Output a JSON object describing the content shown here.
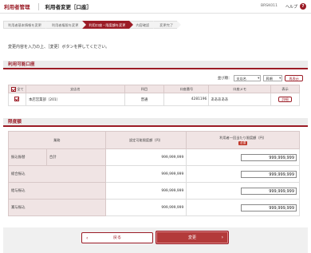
{
  "header": {
    "menu_title": "利用者管理",
    "page_title": "利用者変更［口座］",
    "screen_id": "BRSK011",
    "help_label": "ヘルプ",
    "help_icon": "?"
  },
  "steps": [
    {
      "label": "利用者基本情報を変更",
      "active": false
    },
    {
      "label": "利用者権限を変更",
      "active": false
    },
    {
      "label": "利用口座・限度額を変更",
      "active": true
    },
    {
      "label": "内容確認",
      "active": false
    },
    {
      "label": "変更完了",
      "active": false
    }
  ],
  "instruction": "変更内容を入力の上、［変更］ボタンを押してください。",
  "accounts_section": {
    "title": "利用可能口座",
    "sort": {
      "label": "並び順：",
      "sort_key": "支店名",
      "order": "昇順",
      "resort_button": "再表示"
    },
    "columns": [
      "全て",
      "支店名",
      "科目",
      "口座番号",
      "口座メモ",
      "表示"
    ],
    "rows": [
      {
        "checked": true,
        "branch": "本店営業部（201）",
        "subject": "普通",
        "account_no": "4281196",
        "memo": "あああああ",
        "detail_button": "詳細"
      }
    ]
  },
  "limits_section": {
    "title": "限度額",
    "columns": {
      "business": "業務",
      "bank_limit": "設定可能限度額（円）",
      "user_limit": "利用者一回当たり限度額（円）",
      "required_badge": "必須"
    },
    "rows": [
      {
        "business": "振込振替",
        "sub": "合計",
        "bank_limit": "999,999,999",
        "user_limit": "999,999,999"
      },
      {
        "business": "総合振込",
        "sub": "",
        "bank_limit": "999,999,999",
        "user_limit": "999,999,999"
      },
      {
        "business": "給与振込",
        "sub": "",
        "bank_limit": "999,999,999",
        "user_limit": "999,999,999"
      },
      {
        "business": "賞与振込",
        "sub": "",
        "bank_limit": "999,999,999",
        "user_limit": "999,999,999"
      }
    ]
  },
  "footer": {
    "back_button": "戻る",
    "back_icon": "‹",
    "submit_button": "変更",
    "submit_icon": "›"
  },
  "colors": {
    "accent": "#9b1c26",
    "header_bg": "#f0e4e4"
  }
}
